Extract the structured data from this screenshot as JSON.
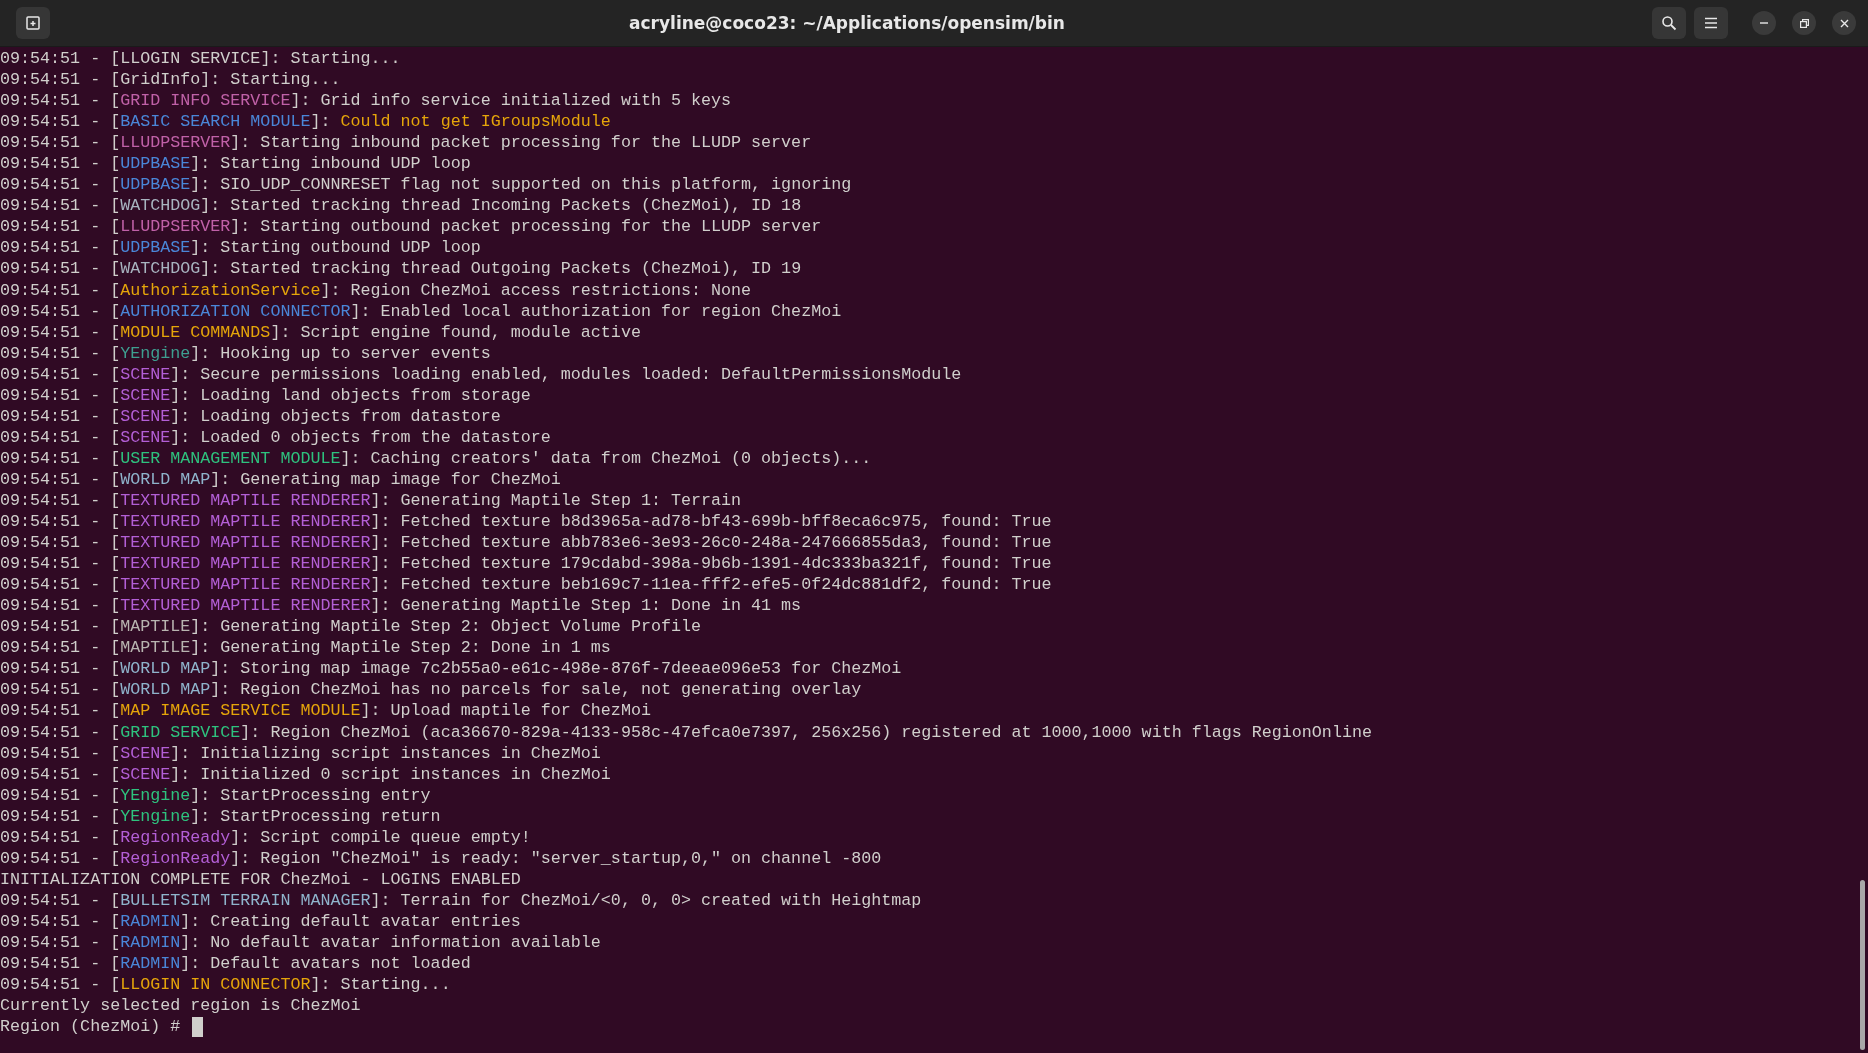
{
  "window": {
    "title": "acryline@coco23: ~/Applications/opensim/bin"
  },
  "lines": [
    {
      "segments": [
        {
          "text": "09:54:51 - ["
        },
        {
          "text": "LLOGIN SERVICE",
          "color": "#d0cfcc"
        },
        {
          "text": "]: Starting..."
        }
      ]
    },
    {
      "segments": [
        {
          "text": "09:54:51 - ["
        },
        {
          "text": "GridInfo",
          "color": "#d0cfcc"
        },
        {
          "text": "]: Starting..."
        }
      ]
    },
    {
      "segments": [
        {
          "text": "09:54:51 - ["
        },
        {
          "text": "GRID INFO SERVICE",
          "color": "#c061a8"
        },
        {
          "text": "]: Grid info service initialized with 5 keys"
        }
      ]
    },
    {
      "segments": [
        {
          "text": "09:54:51 - ["
        },
        {
          "text": "BASIC SEARCH MODULE",
          "color": "#4a86d8"
        },
        {
          "text": "]: "
        },
        {
          "text": "Could not get IGroupsModule",
          "color": "#e5a50a"
        }
      ]
    },
    {
      "segments": [
        {
          "text": "09:54:51 - ["
        },
        {
          "text": "LLUDPSERVER",
          "color": "#c061a8"
        },
        {
          "text": "]: Starting inbound packet processing for the LLUDP server"
        }
      ]
    },
    {
      "segments": [
        {
          "text": "09:54:51 - ["
        },
        {
          "text": "UDPBASE",
          "color": "#4a86d8"
        },
        {
          "text": "]: Starting inbound UDP loop"
        }
      ]
    },
    {
      "segments": [
        {
          "text": "09:54:51 - ["
        },
        {
          "text": "UDPBASE",
          "color": "#4a86d8"
        },
        {
          "text": "]: SIO_UDP_CONNRESET flag not supported on this platform, ignoring"
        }
      ]
    },
    {
      "segments": [
        {
          "text": "09:54:51 - ["
        },
        {
          "text": "WATCHDOG",
          "color": "#a8b4c0"
        },
        {
          "text": "]: Started tracking thread Incoming Packets (ChezMoi), ID 18"
        }
      ]
    },
    {
      "segments": [
        {
          "text": "09:54:51 - ["
        },
        {
          "text": "LLUDPSERVER",
          "color": "#c061a8"
        },
        {
          "text": "]: Starting outbound packet processing for the LLUDP server"
        }
      ]
    },
    {
      "segments": [
        {
          "text": "09:54:51 - ["
        },
        {
          "text": "UDPBASE",
          "color": "#4a86d8"
        },
        {
          "text": "]: Starting outbound UDP loop"
        }
      ]
    },
    {
      "segments": [
        {
          "text": "09:54:51 - ["
        },
        {
          "text": "WATCHDOG",
          "color": "#a8b4c0"
        },
        {
          "text": "]: Started tracking thread Outgoing Packets (ChezMoi), ID 19"
        }
      ]
    },
    {
      "segments": [
        {
          "text": "09:54:51 - ["
        },
        {
          "text": "AuthorizationService",
          "color": "#e5a50a"
        },
        {
          "text": "]: Region ChezMoi access restrictions: None"
        }
      ]
    },
    {
      "segments": [
        {
          "text": "09:54:51 - ["
        },
        {
          "text": "AUTHORIZATION CONNECTOR",
          "color": "#4a86d8"
        },
        {
          "text": "]: Enabled local authorization for region ChezMoi"
        }
      ]
    },
    {
      "segments": [
        {
          "text": "09:54:51 - ["
        },
        {
          "text": "MODULE COMMANDS",
          "color": "#e5a50a"
        },
        {
          "text": "]: Script engine found, module active"
        }
      ]
    },
    {
      "segments": [
        {
          "text": "09:54:51 - ["
        },
        {
          "text": "YEngine",
          "color": "#3e9e90"
        },
        {
          "text": "]: Hooking up to server events"
        }
      ]
    },
    {
      "segments": [
        {
          "text": "09:54:51 - ["
        },
        {
          "text": "SCENE",
          "color": "#b35fd6"
        },
        {
          "text": "]: Secure permissions loading enabled, modules loaded: DefaultPermissionsModule"
        }
      ]
    },
    {
      "segments": [
        {
          "text": "09:54:51 - ["
        },
        {
          "text": "SCENE",
          "color": "#b35fd6"
        },
        {
          "text": "]: Loading land objects from storage"
        }
      ]
    },
    {
      "segments": [
        {
          "text": "09:54:51 - ["
        },
        {
          "text": "SCENE",
          "color": "#b35fd6"
        },
        {
          "text": "]: Loading objects from datastore"
        }
      ]
    },
    {
      "segments": [
        {
          "text": "09:54:51 - ["
        },
        {
          "text": "SCENE",
          "color": "#b35fd6"
        },
        {
          "text": "]: Loaded 0 objects from the datastore"
        }
      ]
    },
    {
      "segments": [
        {
          "text": "09:54:51 - ["
        },
        {
          "text": "USER MANAGEMENT MODULE",
          "color": "#2ec27e"
        },
        {
          "text": "]: Caching creators' data from ChezMoi (0 objects)..."
        }
      ]
    },
    {
      "segments": [
        {
          "text": "09:54:51 - ["
        },
        {
          "text": "WORLD MAP",
          "color": "#8fb4cc"
        },
        {
          "text": "]: Generating map image for ChezMoi"
        }
      ]
    },
    {
      "segments": [
        {
          "text": "09:54:51 - ["
        },
        {
          "text": "TEXTURED MAPTILE RENDERER",
          "color": "#b35fd6"
        },
        {
          "text": "]: Generating Maptile Step 1: Terrain"
        }
      ]
    },
    {
      "segments": [
        {
          "text": "09:54:51 - ["
        },
        {
          "text": "TEXTURED MAPTILE RENDERER",
          "color": "#b35fd6"
        },
        {
          "text": "]: Fetched texture b8d3965a-ad78-bf43-699b-bff8eca6c975, found: True"
        }
      ]
    },
    {
      "segments": [
        {
          "text": "09:54:51 - ["
        },
        {
          "text": "TEXTURED MAPTILE RENDERER",
          "color": "#b35fd6"
        },
        {
          "text": "]: Fetched texture abb783e6-3e93-26c0-248a-247666855da3, found: True"
        }
      ]
    },
    {
      "segments": [
        {
          "text": "09:54:51 - ["
        },
        {
          "text": "TEXTURED MAPTILE RENDERER",
          "color": "#b35fd6"
        },
        {
          "text": "]: Fetched texture 179cdabd-398a-9b6b-1391-4dc333ba321f, found: True"
        }
      ]
    },
    {
      "segments": [
        {
          "text": "09:54:51 - ["
        },
        {
          "text": "TEXTURED MAPTILE RENDERER",
          "color": "#b35fd6"
        },
        {
          "text": "]: Fetched texture beb169c7-11ea-fff2-efe5-0f24dc881df2, found: True"
        }
      ]
    },
    {
      "segments": [
        {
          "text": "09:54:51 - ["
        },
        {
          "text": "TEXTURED MAPTILE RENDERER",
          "color": "#b35fd6"
        },
        {
          "text": "]: Generating Maptile Step 1: Done in 41 ms"
        }
      ]
    },
    {
      "segments": [
        {
          "text": "09:54:51 - ["
        },
        {
          "text": "MAPTILE",
          "color": "#b8b4b0"
        },
        {
          "text": "]: Generating Maptile Step 2: Object Volume Profile"
        }
      ]
    },
    {
      "segments": [
        {
          "text": "09:54:51 - ["
        },
        {
          "text": "MAPTILE",
          "color": "#b8b4b0"
        },
        {
          "text": "]: Generating Maptile Step 2: Done in 1 ms"
        }
      ]
    },
    {
      "segments": [
        {
          "text": "09:54:51 - ["
        },
        {
          "text": "WORLD MAP",
          "color": "#8fb4cc"
        },
        {
          "text": "]: Storing map image 7c2b55a0-e61c-498e-876f-7deeae096e53 for ChezMoi"
        }
      ]
    },
    {
      "segments": [
        {
          "text": "09:54:51 - ["
        },
        {
          "text": "WORLD MAP",
          "color": "#8fb4cc"
        },
        {
          "text": "]: Region ChezMoi has no parcels for sale, not generating overlay"
        }
      ]
    },
    {
      "segments": [
        {
          "text": "09:54:51 - ["
        },
        {
          "text": "MAP IMAGE SERVICE MODULE",
          "color": "#e5a50a"
        },
        {
          "text": "]: Upload maptile for ChezMoi"
        }
      ]
    },
    {
      "segments": [
        {
          "text": "09:54:51 - ["
        },
        {
          "text": "GRID SERVICE",
          "color": "#2ec27e"
        },
        {
          "text": "]: Region ChezMoi (aca36670-829a-4133-958c-47efca0e7397, 256x256) registered at 1000,1000 with flags RegionOnline"
        }
      ]
    },
    {
      "segments": [
        {
          "text": "09:54:51 - ["
        },
        {
          "text": "SCENE",
          "color": "#b35fd6"
        },
        {
          "text": "]: Initializing script instances in ChezMoi"
        }
      ]
    },
    {
      "segments": [
        {
          "text": "09:54:51 - ["
        },
        {
          "text": "SCENE",
          "color": "#b35fd6"
        },
        {
          "text": "]: Initialized 0 script instances in ChezMoi"
        }
      ]
    },
    {
      "segments": [
        {
          "text": "09:54:51 - ["
        },
        {
          "text": "YEngine",
          "color": "#2ec27e"
        },
        {
          "text": "]: StartProcessing entry"
        }
      ]
    },
    {
      "segments": [
        {
          "text": "09:54:51 - ["
        },
        {
          "text": "YEngine",
          "color": "#2ec27e"
        },
        {
          "text": "]: StartProcessing return"
        }
      ]
    },
    {
      "segments": [
        {
          "text": "09:54:51 - ["
        },
        {
          "text": "RegionReady",
          "color": "#b35fd6"
        },
        {
          "text": "]: Script compile queue empty!"
        }
      ]
    },
    {
      "segments": [
        {
          "text": "09:54:51 - ["
        },
        {
          "text": "RegionReady",
          "color": "#b35fd6"
        },
        {
          "text": "]: Region \"ChezMoi\" is ready: \"server_startup,0,\" on channel -800"
        }
      ]
    },
    {
      "segments": [
        {
          "text": "INITIALIZATION COMPLETE FOR ChezMoi - LOGINS ENABLED"
        }
      ]
    },
    {
      "segments": [
        {
          "text": "09:54:51 - ["
        },
        {
          "text": "BULLETSIM TERRAIN MANAGER",
          "color": "#8fb4cc"
        },
        {
          "text": "]: Terrain for ChezMoi/<0, 0, 0> created with Heightmap"
        }
      ]
    },
    {
      "segments": [
        {
          "text": "09:54:51 - ["
        },
        {
          "text": "RADMIN",
          "color": "#4a86d8"
        },
        {
          "text": "]: Creating default avatar entries"
        }
      ]
    },
    {
      "segments": [
        {
          "text": "09:54:51 - ["
        },
        {
          "text": "RADMIN",
          "color": "#4a86d8"
        },
        {
          "text": "]: No default avatar information available"
        }
      ]
    },
    {
      "segments": [
        {
          "text": "09:54:51 - ["
        },
        {
          "text": "RADMIN",
          "color": "#4a86d8"
        },
        {
          "text": "]: Default avatars not loaded"
        }
      ]
    },
    {
      "segments": [
        {
          "text": "09:54:51 - ["
        },
        {
          "text": "LLOGIN IN CONNECTOR",
          "color": "#e5a50a"
        },
        {
          "text": "]: Starting..."
        }
      ]
    },
    {
      "segments": [
        {
          "text": "Currently selected region is ChezMoi"
        }
      ]
    }
  ],
  "prompt": {
    "text": "Region (ChezMoi) #"
  }
}
